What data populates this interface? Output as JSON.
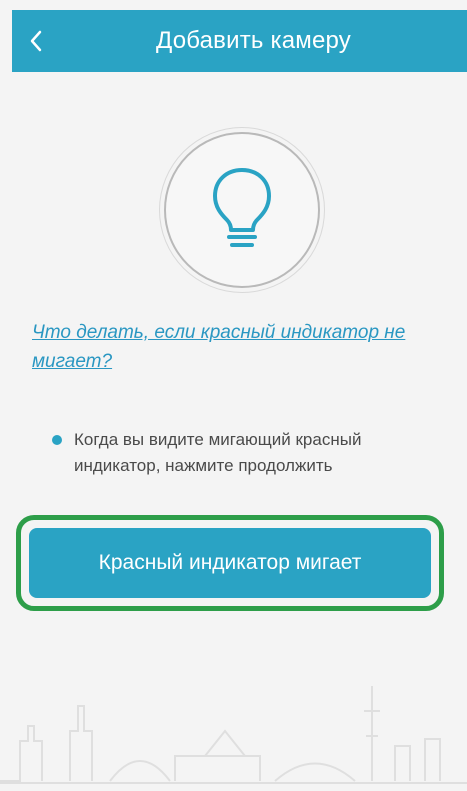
{
  "header": {
    "title": "Добавить камеру",
    "back_icon": "back-icon"
  },
  "main": {
    "bulb_icon": "light-bulb-icon",
    "help_link": "Что делать, если красный индикатор не мигает?",
    "instruction_text": "Когда вы видите мигающий красный индикатор, нажмите продолжить",
    "blink_button_label": "Красный индикатор мигает"
  },
  "colors": {
    "accent": "#2aa3c4",
    "highlight_border": "#2d9e49",
    "background": "#f4f4f4"
  }
}
